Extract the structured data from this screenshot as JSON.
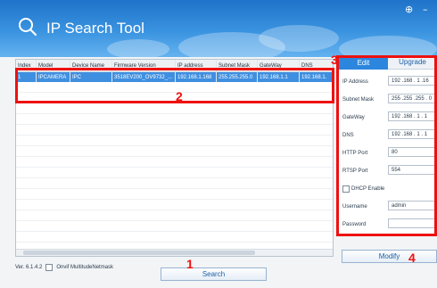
{
  "window": {
    "title": "IP Search Tool",
    "controls": {
      "settings": "⊕",
      "minimize": "–"
    }
  },
  "table": {
    "columns": [
      "Index",
      "Model",
      "Device Name",
      "Firmware Version",
      "IP address",
      "Subnet Mask",
      "GateWay",
      "DNS"
    ],
    "rows": [
      {
        "index": "1",
        "model": "IPCAMERA",
        "device_name": "IPC",
        "firmware": "3518EV200_OV9732_...",
        "ip": "192.168.1.168",
        "subnet": "255.255.255.0",
        "gateway": "192.168.1.1",
        "dns": "192.168.1."
      }
    ]
  },
  "callouts": {
    "one": "1",
    "two": "2",
    "three": "3",
    "four": "4"
  },
  "footer": {
    "version": "Ver. 6.1.4.2",
    "onvif_label": "Onvif MultitudeNetmask",
    "search_label": "Search"
  },
  "panel": {
    "tab_edit": "Edit",
    "tab_upgrade": "Upgrade",
    "ip_label": "IP Address",
    "ip_value": "192 .168 . 1 .16",
    "subnet_label": "Subnet Mask",
    "subnet_value": "255 .255 .255 . 0",
    "gateway_label": "GateWay",
    "gateway_value": "192 .168 . 1 . 1",
    "dns_label": "DNS",
    "dns_value": "192 .168 . 1 . 1",
    "http_label": "HTTP Port",
    "http_value": "80",
    "rtsp_label": "RTSP Port",
    "rtsp_value": "554",
    "dhcp_label": "DHCP Enable",
    "username_label": "Username",
    "username_value": "admin",
    "password_label": "Password",
    "password_value": "",
    "modify_label": "Modify"
  },
  "colors": {
    "header": "#2a82d6",
    "selected_row": "#3f8fe0",
    "callout": "#ee1111",
    "active_tab": "#2c86de"
  }
}
